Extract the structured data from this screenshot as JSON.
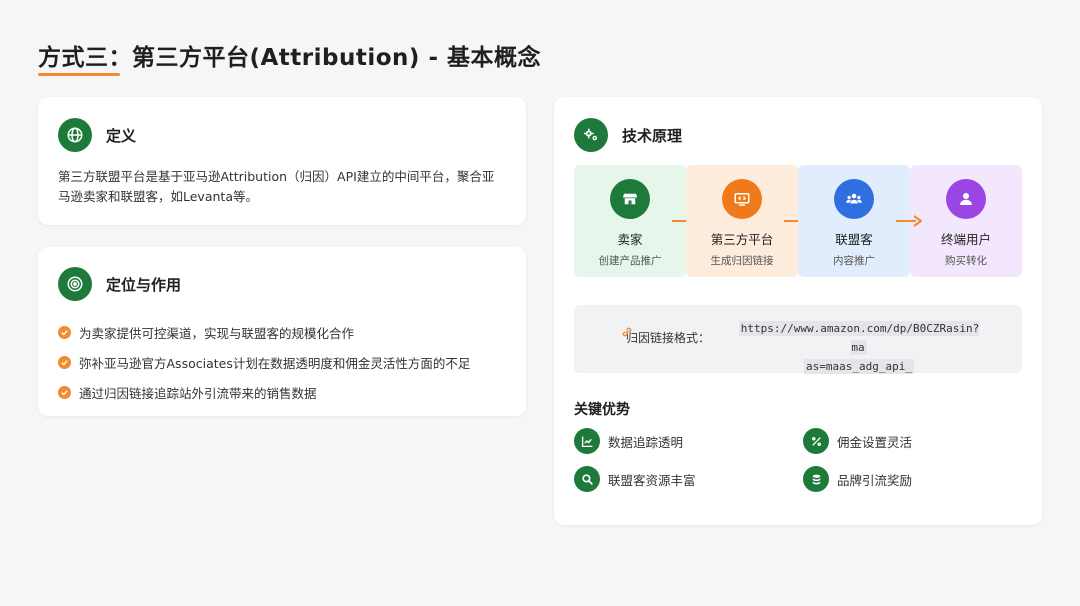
{
  "page": {
    "title": "方式三：第三方平台(Attribution) - 基本概念"
  },
  "definition": {
    "title": "定义",
    "text": "第三方联盟平台是基于亚马逊Attribution（归因）API建立的中间平台，聚合亚马逊卖家和联盟客，如Levanta等。"
  },
  "positioning": {
    "title": "定位与作用",
    "items": [
      "为卖家提供可控渠道，实现与联盟客的规模化合作",
      "弥补亚马逊官方Associates计划在数据透明度和佣金灵活性方面的不足",
      "通过归因链接追踪站外引流带来的销售数据"
    ]
  },
  "principle": {
    "title": "技术原理",
    "flow": [
      {
        "name": "卖家",
        "sub": "创建产品推广",
        "icon": "store-icon",
        "bg": "#e6f6ea",
        "color": "#1e7a3a"
      },
      {
        "name": "第三方平台",
        "sub": "生成归因链接",
        "icon": "code-icon",
        "bg": "#fdebdc",
        "color": "#f07a1a"
      },
      {
        "name": "联盟客",
        "sub": "内容推广",
        "icon": "users-icon",
        "bg": "#e1ecfd",
        "color": "#2f6fe0"
      },
      {
        "name": "终端用户",
        "sub": "购买转化",
        "icon": "user-icon",
        "bg": "#f2e7fd",
        "color": "#9b45e4"
      }
    ],
    "link_label": "归因链接格式：",
    "link_line1": "https://www.amazon.com/dp/B0CZRasin?ma",
    "link_line2": "as=maas_adg_api_"
  },
  "advantages": {
    "title": "关键优势",
    "items": [
      {
        "label": "数据追踪透明",
        "icon": "chart-line-icon"
      },
      {
        "label": "佣金设置灵活",
        "icon": "percent-icon"
      },
      {
        "label": "联盟客资源丰富",
        "icon": "search-icon"
      },
      {
        "label": "品牌引流奖励",
        "icon": "coins-icon"
      }
    ]
  },
  "colors": {
    "accent_orange": "#f28a2e",
    "brand_green": "#1e7a3a"
  }
}
